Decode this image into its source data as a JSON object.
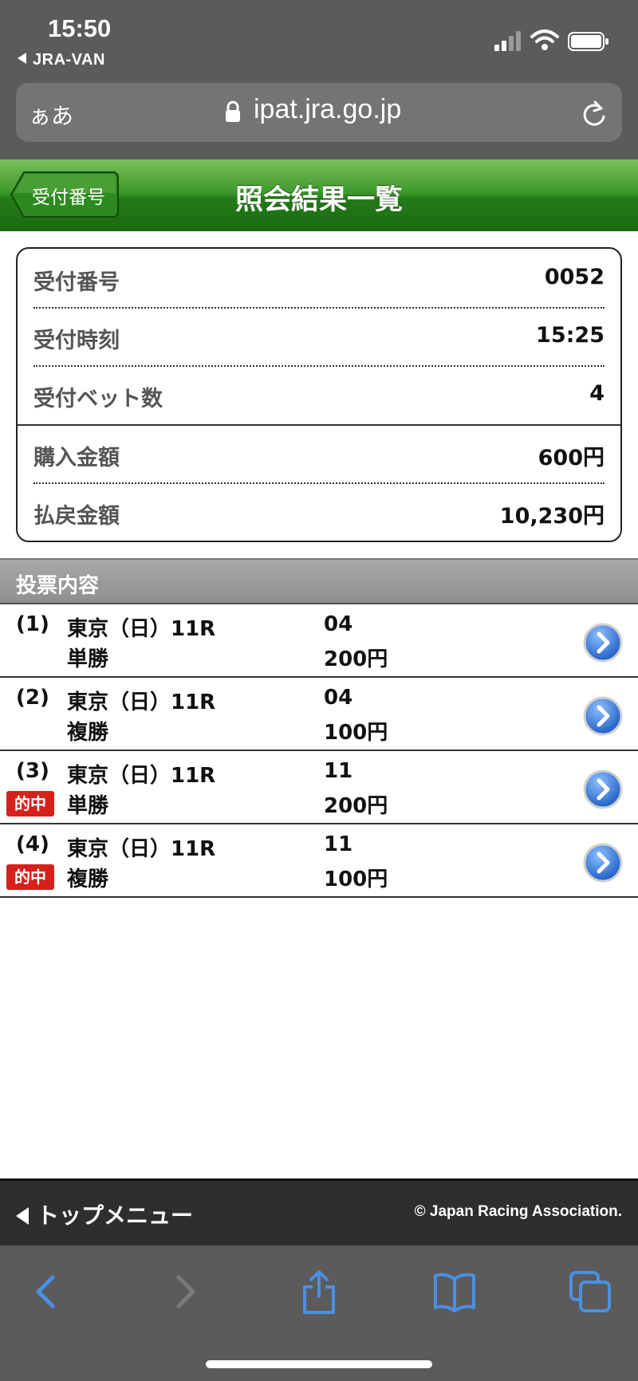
{
  "status_bar": {
    "time": "15:50",
    "back_app": "JRA-VAN"
  },
  "address_bar": {
    "text_size_label": "ぁあ",
    "url": "ipat.jra.go.jp"
  },
  "header": {
    "back_label": "受付番号",
    "title": "照会結果一覧"
  },
  "summary": {
    "rows": [
      {
        "label": "受付番号",
        "value": "0052"
      },
      {
        "label": "受付時刻",
        "value": "15:25"
      },
      {
        "label": "受付ベット数",
        "value": "4"
      },
      {
        "label": "購入金額",
        "value": "600円"
      },
      {
        "label": "払戻金額",
        "value": "10,230円"
      }
    ]
  },
  "section": {
    "title": "投票内容"
  },
  "tickets": [
    {
      "num": "(1)",
      "race": "東京（日）11R",
      "type": "単勝",
      "horse": "04",
      "amount": "200円",
      "hit": ""
    },
    {
      "num": "(2)",
      "race": "東京（日）11R",
      "type": "複勝",
      "horse": "04",
      "amount": "100円",
      "hit": ""
    },
    {
      "num": "(3)",
      "race": "東京（日）11R",
      "type": "単勝",
      "horse": "11",
      "amount": "200円",
      "hit": "的中"
    },
    {
      "num": "(4)",
      "race": "東京（日）11R",
      "type": "複勝",
      "horse": "11",
      "amount": "100円",
      "hit": "的中"
    }
  ],
  "footer": {
    "top_menu": "トップメニュー",
    "copyright": "© Japan Racing Association."
  },
  "colors": {
    "header_green": "#237a18",
    "hit_red": "#d6201c",
    "toolbar_blue": "#4a90e2"
  }
}
